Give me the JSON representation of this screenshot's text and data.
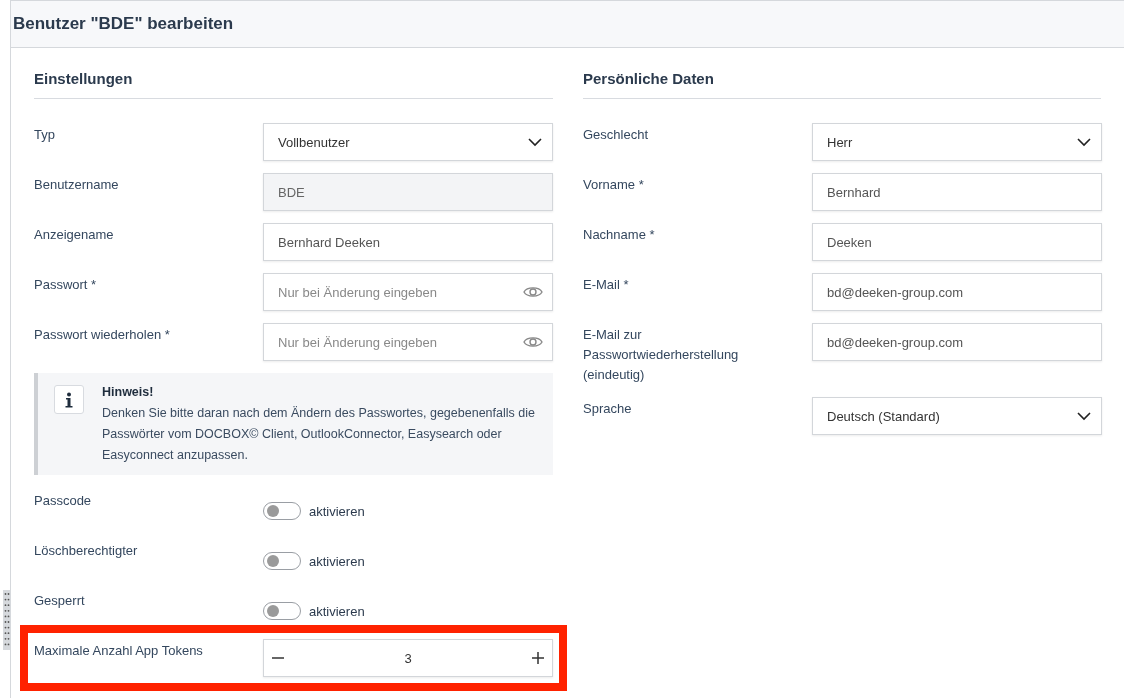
{
  "page": {
    "title": "Benutzer \"BDE\" bearbeiten"
  },
  "sections": [
    {
      "heading": "Einstellungen",
      "fields": [
        {
          "kind": "select",
          "label": "Typ",
          "value": "Vollbenutzer"
        },
        {
          "kind": "input",
          "label": "Benutzername",
          "value": "BDE",
          "disabled": true
        },
        {
          "kind": "input",
          "label": "Anzeigename",
          "value": "Bernhard Deeken",
          "disabled": false
        },
        {
          "kind": "password",
          "label": "Passwort *",
          "placeholder": "Nur bei Änderung eingeben"
        },
        {
          "kind": "password",
          "label": "Passwort wiederholen *",
          "placeholder": "Nur bei Änderung eingeben"
        },
        {
          "kind": "note",
          "title": "Hinweis!",
          "text": "Denken Sie bitte daran nach dem Ändern des Passwortes, gegebenenfalls die Passwörter vom DOCBOX© Client, OutlookConnector, Easysearch oder Easyconnect anzupassen."
        },
        {
          "kind": "toggle",
          "label": "Passcode",
          "on": false,
          "text": "aktivieren"
        },
        {
          "kind": "toggle",
          "label": "Löschberechtigter",
          "on": false,
          "text": "aktivieren"
        },
        {
          "kind": "toggle",
          "label": "Gesperrt",
          "on": false,
          "text": "aktivieren"
        },
        {
          "kind": "stepper",
          "label": "Maximale Anzahl App Tokens",
          "value": "3",
          "highlighted": true
        }
      ]
    },
    {
      "heading": "Persönliche Daten",
      "fields": [
        {
          "kind": "select",
          "label": "Geschlecht",
          "value": "Herr"
        },
        {
          "kind": "input",
          "label": "Vorname *",
          "value": "Bernhard",
          "disabled": false
        },
        {
          "kind": "input",
          "label": "Nachname *",
          "value": "Deeken",
          "disabled": false
        },
        {
          "kind": "input",
          "label": "E-Mail *",
          "value": "bd@deeken-group.com",
          "disabled": false
        },
        {
          "kind": "input",
          "label": "E-Mail zur Passwortwiederherstellung (eindeutig)",
          "value": "bd@deeken-group.com",
          "disabled": false
        },
        {
          "kind": "select",
          "label": "Sprache",
          "value": "Deutsch (Standard)"
        }
      ]
    }
  ]
}
